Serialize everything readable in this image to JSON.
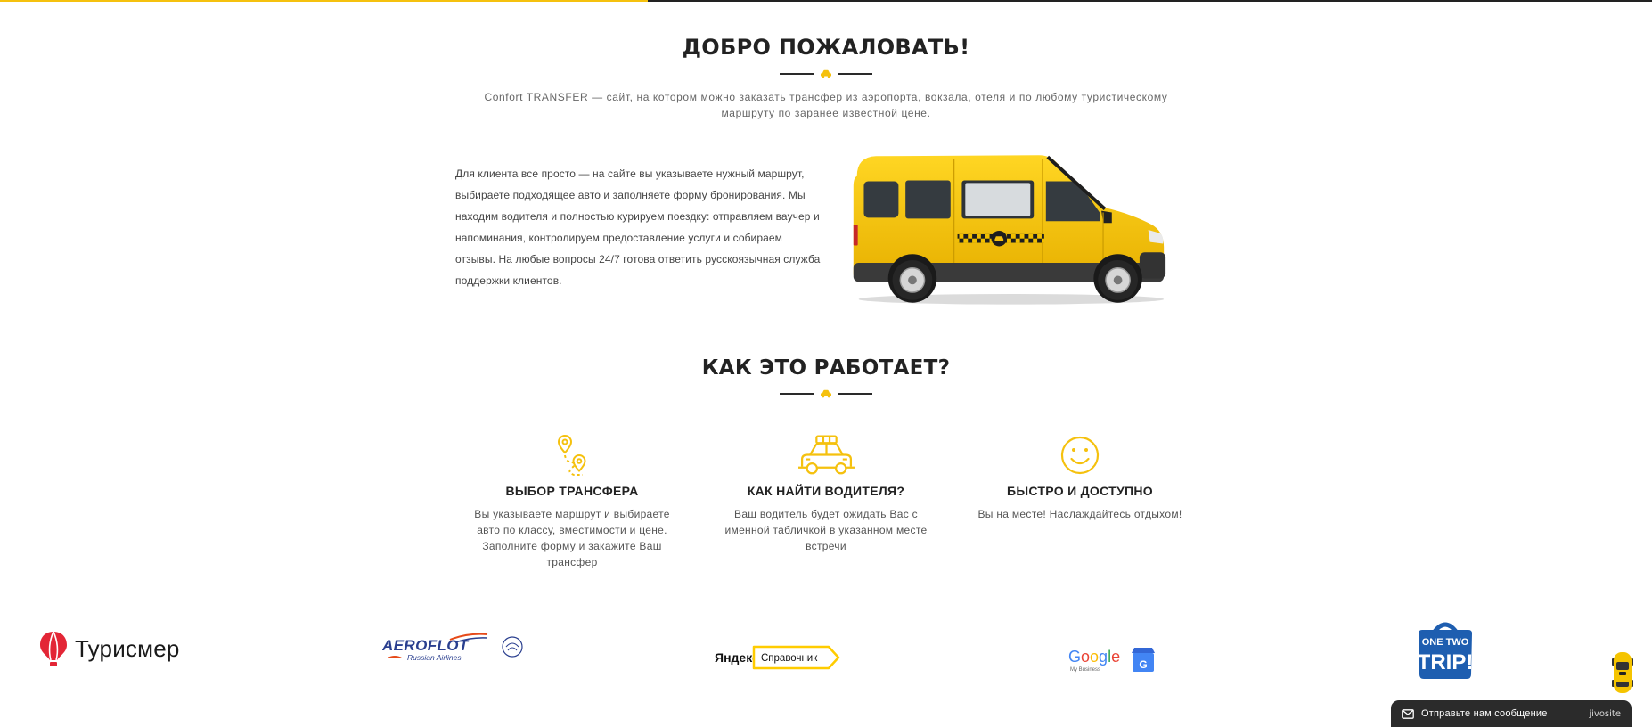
{
  "colors": {
    "accent": "#f5c10e",
    "heading": "#222222",
    "text": "#555555",
    "chat_bg": "#2b2b2b"
  },
  "welcome": {
    "title": "ДОБРО ПОЖАЛОВАТЬ!",
    "divider_icon": "taxi-icon",
    "intro": "Confort TRANSFER — сайт, на котором можно заказать трансфер из аэропорта, вокзала, отеля и по любому туристическому маршруту по заранее известной цене."
  },
  "about": {
    "text": "Для клиента все просто — на сайте вы указываете нужный маршрут, выбираете подходящее авто и заполняете форму бронирования. Мы находим водителя и полностью курируем поездку: отправляем ваучер и напоминания, контролируем предоставление услуги и собираем отзывы. На любые вопросы 24/7 готова ответить русскоязычная служба поддержки клиентов.",
    "image_icon": "yellow-taxi-van"
  },
  "how": {
    "title": "КАК ЭТО РАБОТАЕТ?",
    "divider_icon": "taxi-icon",
    "steps": [
      {
        "icon": "route-pins-icon",
        "title": "ВЫБОР ТРАНСФЕРА",
        "text": "Вы указываете маршрут и выбираете авто по классу, вместимости и цене. Заполните форму и закажите Ваш трансфер"
      },
      {
        "icon": "taxi-car-icon",
        "title": "КАК НАЙТИ ВОДИТЕЛЯ?",
        "text": "Ваш водитель будет ожидать Вас с именной табличкой в указанном месте встречи"
      },
      {
        "icon": "smiley-icon",
        "title": "БЫСТРО И ДОСТУПНО",
        "text": "Вы на месте! Наслаждайтесь отдыхом!"
      }
    ]
  },
  "partners": {
    "turister": {
      "wordmark": "Турисмер",
      "icon": "balloon-icon"
    },
    "aeroflot": {
      "wordmark": "AEROFLOT",
      "tagline": "Russian Airlines"
    },
    "yandex": {
      "wordmark": "Яндекс",
      "product": "Справочник"
    },
    "google": {
      "wordmark": "Google",
      "tagline": "My Business",
      "badge": "G",
      "letter_colors": [
        "#4285f4",
        "#ea4335",
        "#fbbc05",
        "#4285f4",
        "#34a853",
        "#ea4335"
      ]
    },
    "onetwotrip": {
      "line1": "ONE TWO",
      "line2": "TRIP!"
    }
  },
  "widgets": {
    "side_icon": "taxi-top-view-icon",
    "chat": {
      "icon": "envelope-icon",
      "label": "Отправьте нам сообщение",
      "brand": "jivosite"
    }
  }
}
